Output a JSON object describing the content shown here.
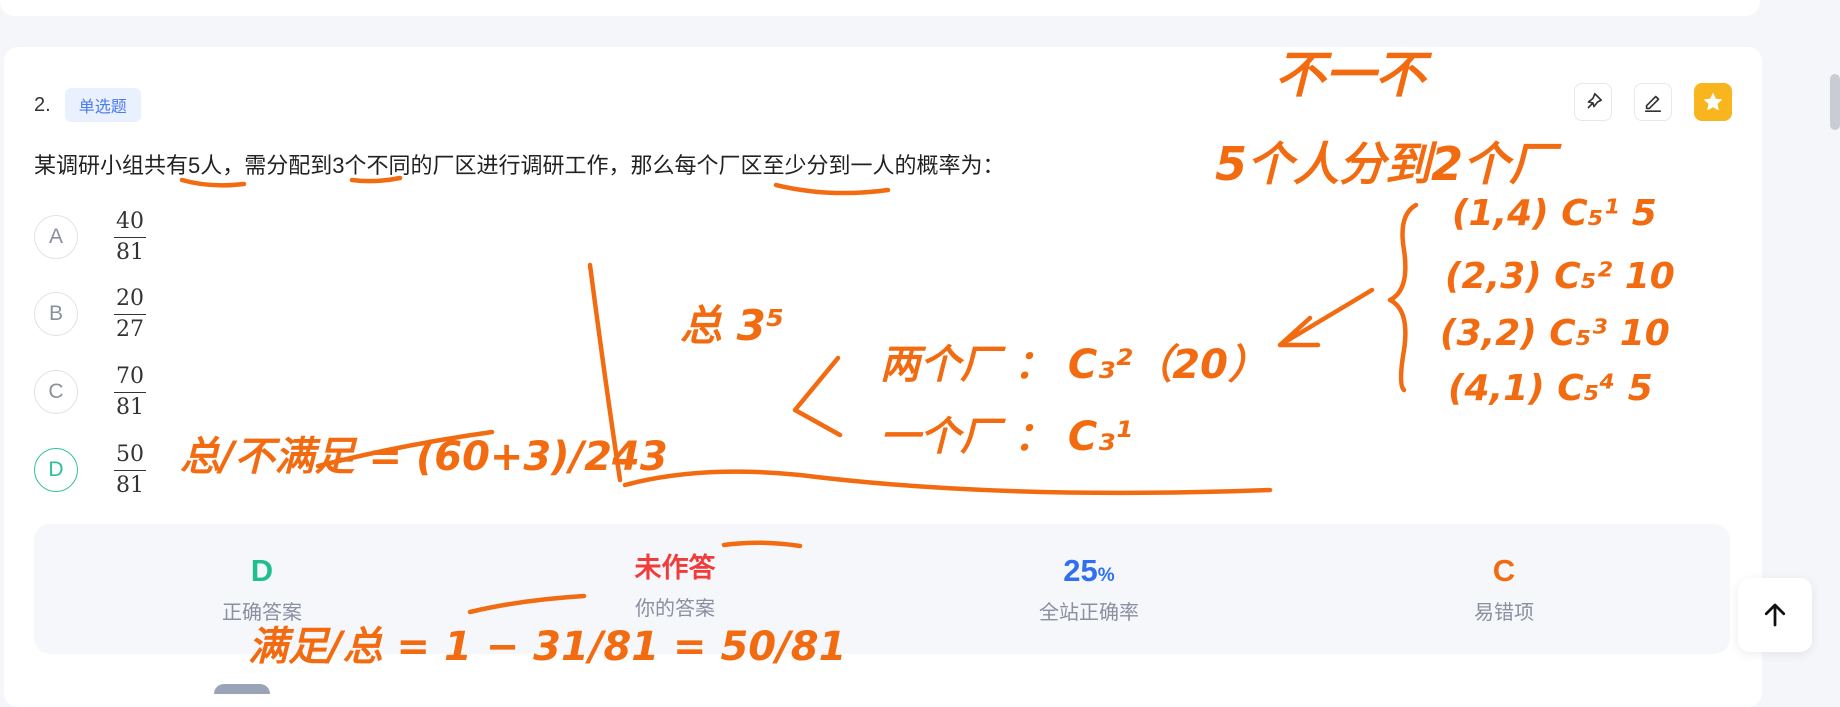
{
  "question": {
    "number": "2.",
    "type_badge": "单选题",
    "stem": "某调研小组共有5人，需分配到3个不同的厂区进行调研工作，那么每个厂区至少分到一人的概率为：",
    "options": [
      {
        "letter": "A",
        "numerator": "40",
        "denominator": "81",
        "state": "normal"
      },
      {
        "letter": "B",
        "numerator": "20",
        "denominator": "27",
        "state": "normal"
      },
      {
        "letter": "C",
        "numerator": "70",
        "denominator": "81",
        "state": "normal"
      },
      {
        "letter": "D",
        "numerator": "50",
        "denominator": "81",
        "state": "correct"
      }
    ]
  },
  "toolbar": {
    "pin_icon": "pin-icon",
    "edit_icon": "edit-icon",
    "favorite_icon": "star-icon"
  },
  "stats": {
    "correct_answer": {
      "value": "D",
      "label": "正确答案",
      "color": "#1fbf8f"
    },
    "your_answer": {
      "value": "未作答",
      "label": "你的答案",
      "color": "#f23c3c"
    },
    "accuracy": {
      "value": "25",
      "unit": "%",
      "label": "全站正确率",
      "color": "#2f6ff0"
    },
    "common_wrong": {
      "value": "C",
      "label": "易错项",
      "color": "#f26b10"
    }
  },
  "scroll_top_icon": "arrow-up-icon",
  "handwriting": {
    "color": "#f26b10",
    "lines": [
      "不一不",
      "5个人分到2个厂",
      "总 3⁵",
      "两个厂 ： C₃²（20）",
      "一个厂 ： C₃¹",
      "(1,4) C₅¹ 5",
      "(2,3) C₅² 10",
      "(3,2) C₅³ 10",
      "(4,1) C₅⁴ 5",
      "总/不满足 = (60+3)/243",
      "满足/总 = 1 − 31/81 = 50/81"
    ]
  }
}
